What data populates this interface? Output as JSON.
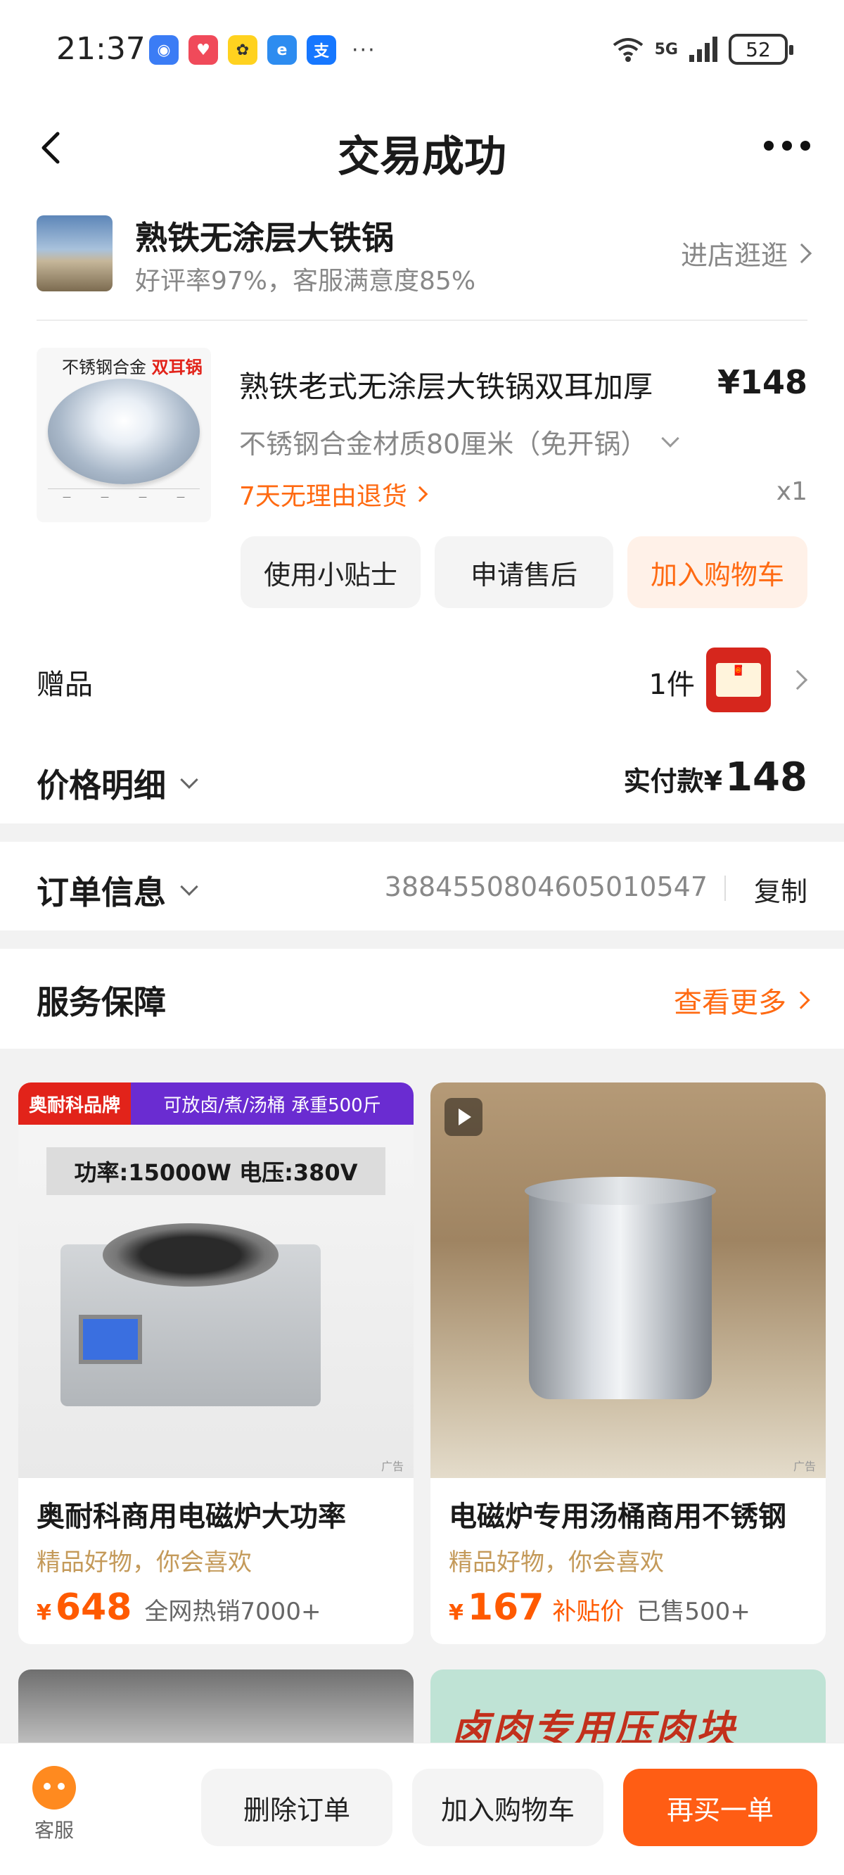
{
  "status_bar": {
    "time": "21:37",
    "network": "5G",
    "battery": "52"
  },
  "header": {
    "title": "交易成功"
  },
  "shop": {
    "name": "熟铁无涂层大铁锅",
    "rating": "好评率97%，客服满意度85%",
    "visit_label": "进店逛逛"
  },
  "product": {
    "image_label_prefix": "不锈钢合金",
    "image_label_highlight": "双耳锅",
    "title": "熟铁老式无涂层大铁锅双耳加厚",
    "price": "¥148",
    "spec": "不锈钢合金材质80厘米（免开锅）",
    "return_policy": "7天无理由退货",
    "quantity": "x1",
    "buttons": {
      "tip": "使用小贴士",
      "after_sale": "申请售后",
      "add_cart": "加入购物车"
    }
  },
  "gift": {
    "label": "赠品",
    "count": "1件"
  },
  "price_detail": {
    "label": "价格明细",
    "paid_label": "实付款¥",
    "paid_value": "148"
  },
  "order_info": {
    "label": "订单信息",
    "number": "3884550804605010547",
    "copy_label": "复制"
  },
  "service": {
    "label": "服务保障",
    "more_label": "查看更多"
  },
  "recommendations": [
    {
      "brand_tag": "奥耐科品牌",
      "feature_tag": "可放卤/煮/汤桶 承重500斤",
      "spec_band": "功率:15000W   电压:380V",
      "name": "奥耐科商用电磁炉大功率",
      "subtitle": "精品好物，你会喜欢",
      "currency": "¥",
      "price": "648",
      "note": "全网热销7000+",
      "ad": "广告"
    },
    {
      "name": "电磁炉专用汤桶商用不锈钢",
      "subtitle": "精品好物，你会喜欢",
      "currency": "¥",
      "price": "167",
      "tag": "补贴价",
      "note": "已售500+",
      "ad": "广告"
    }
  ],
  "peek_right_text": "卤肉专用压肉块",
  "bottom_bar": {
    "service_label": "客服",
    "delete_order": "删除订单",
    "add_cart": "加入购物车",
    "buy_again": "再买一单"
  },
  "colors": {
    "accent": "#ff5d14",
    "orange_text": "#ff6a12",
    "brand_red": "#e2231a",
    "feature_purple": "#6a2cd1"
  }
}
